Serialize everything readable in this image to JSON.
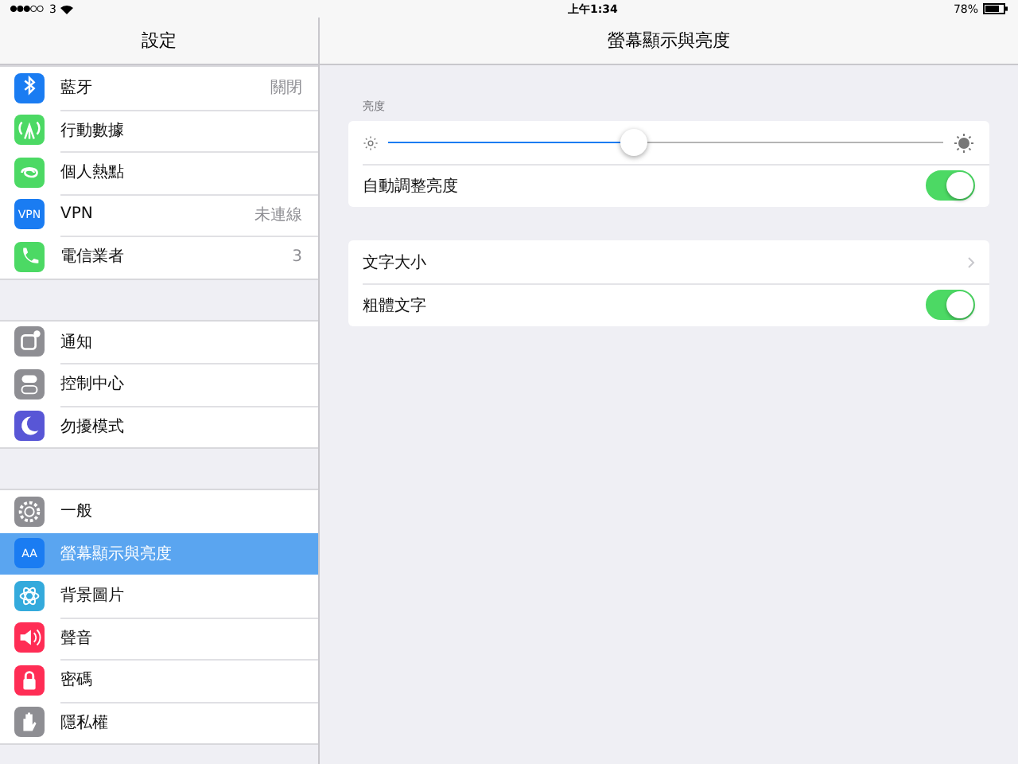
{
  "status_bar": {
    "carrier": "3",
    "time": "上午1:34",
    "battery": "78%"
  },
  "sidebar": {
    "title": "設定",
    "groups": [
      {
        "items": [
          {
            "label": "藍牙",
            "value": "關閉",
            "color": "#1a7cf2",
            "selected": false
          },
          {
            "label": "行動數據",
            "color": "#4cd964",
            "selected": false
          },
          {
            "label": "個人熱點",
            "color": "#4cd964",
            "selected": false
          },
          {
            "label": "VPN",
            "value": "未連線",
            "color": "#1a7cf2",
            "icon_text": "VPN",
            "selected": false
          },
          {
            "label": "電信業者",
            "value": "3",
            "color": "#4cd964",
            "selected": false
          }
        ]
      },
      {
        "items": [
          {
            "label": "通知",
            "color": "#8e8e93",
            "selected": false
          },
          {
            "label": "控制中心",
            "color": "#8e8e93",
            "selected": false
          },
          {
            "label": "勿擾模式",
            "color": "#5856d6",
            "selected": false
          }
        ]
      },
      {
        "items": [
          {
            "label": "一般",
            "color": "#8e8e93",
            "selected": false
          },
          {
            "label": "螢幕顯示與亮度",
            "color": "#1a7cf2",
            "icon_text": "AA",
            "selected": true
          },
          {
            "label": "背景圖片",
            "color": "#34aadc",
            "selected": false
          },
          {
            "label": "聲音",
            "color": "#ff2d55",
            "selected": false
          },
          {
            "label": "密碼",
            "color": "#ff2d55",
            "selected": false
          },
          {
            "label": "隱私權",
            "color": "#8e8e93",
            "selected": false
          }
        ]
      }
    ]
  },
  "detail": {
    "title": "螢幕顯示與亮度",
    "sections": [
      {
        "header": "亮度",
        "rows": [
          {
            "kind": "slider",
            "level": 0.44
          },
          {
            "kind": "toggle",
            "label": "自動調整亮度",
            "on": true
          }
        ]
      },
      {
        "rows": [
          {
            "kind": "link",
            "label": "文字大小"
          },
          {
            "kind": "toggle",
            "label": "粗體文字",
            "on": true
          }
        ]
      }
    ]
  }
}
